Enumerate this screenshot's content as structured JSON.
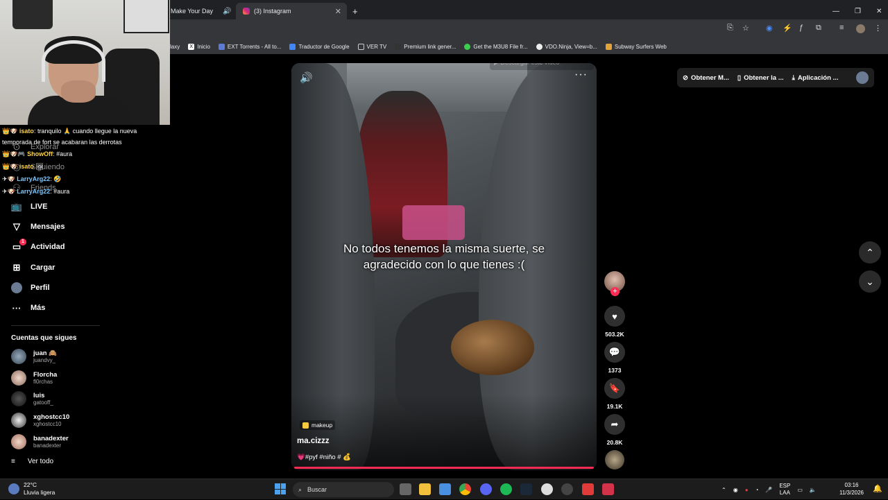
{
  "browser": {
    "tabs": [
      {
        "title": "Make Your Day",
        "active": false
      },
      {
        "title": "(3) Instagram",
        "active": true
      }
    ],
    "bookmarks": [
      "laxy",
      "Inicio",
      "EXT Torrents - All to...",
      "Traductor de Google",
      "VER TV",
      "Premium link gener...",
      "Get the M3U8 File fr...",
      "VDO.Ninja, View=b...",
      "Subway Surfers Web"
    ]
  },
  "chat": [
    {
      "user": "isato",
      "msg": ": tranquilo",
      "msg2": "cuando llegue la nueva"
    },
    {
      "line": "temporada de fort se acabaran las derrotas"
    },
    {
      "user": "ShowOff",
      "msg": ": #aura"
    },
    {
      "user": "isato",
      "msg": ""
    },
    {
      "user": "LarryArg22",
      "msg": ":"
    },
    {
      "user": "LarryArg22",
      "msg": ": #aura"
    }
  ],
  "sidebar": {
    "faded_items": [
      "Explorar",
      "Siguiendo",
      "Friends"
    ],
    "items": [
      {
        "label": "LIVE",
        "icon": "live-icon"
      },
      {
        "label": "Mensajes",
        "icon": "messages-icon"
      },
      {
        "label": "Actividad",
        "icon": "activity-icon",
        "badge": "1"
      },
      {
        "label": "Cargar",
        "icon": "upload-icon"
      },
      {
        "label": "Perfil",
        "icon": "profile-icon"
      },
      {
        "label": "Más",
        "icon": "more-icon"
      }
    ],
    "following_title": "Cuentas que sigues",
    "following": [
      {
        "name": "juan 🙈",
        "user": "juandvy_"
      },
      {
        "name": "Florcha",
        "user": "fl0rchas"
      },
      {
        "name": "luis",
        "user": "gatooff_"
      },
      {
        "name": "xghostcc10",
        "user": "xghostcc10"
      },
      {
        "name": "banadexter",
        "user": "banadexter"
      }
    ],
    "see_all": "Ver todo"
  },
  "video": {
    "caption": "No todos tenemos la misma suerte, se agradecido con lo que tienes :(",
    "download_hint": "▶ Descargar este video",
    "tag": "makeup",
    "author": "ma.cizzz",
    "description": "💗#pyf #niño # 💰",
    "progress": 1.0
  },
  "actions": {
    "likes": "503.2K",
    "comments": "1373",
    "saves": "19.1K",
    "shares": "20.8K"
  },
  "topbar": {
    "btn1": "Obtener M...",
    "btn2": "Obtener la ...",
    "btn3": "Aplicación ..."
  },
  "taskbar": {
    "temp": "22°C",
    "weather": "Lluvia ligera",
    "search": "Buscar",
    "lang1": "ESP",
    "lang2": "LAA",
    "time": "03:16",
    "date": "11/3/2026"
  },
  "colors": {
    "accent": "#fe2c55"
  }
}
